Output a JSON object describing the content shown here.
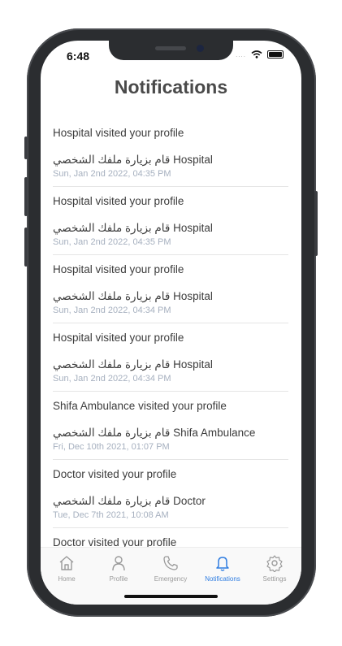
{
  "status": {
    "time": "6:48",
    "signal_dots": "...."
  },
  "page": {
    "title": "Notifications"
  },
  "notifications": [
    {
      "line1": "Hospital visited your profile",
      "line2": "قام بزيارة ملفك الشخصي Hospital",
      "date": "Sun, Jan 2nd 2022, 04:35 PM"
    },
    {
      "line1": "Hospital visited your profile",
      "line2": "قام بزيارة ملفك الشخصي Hospital",
      "date": "Sun, Jan 2nd 2022, 04:35 PM"
    },
    {
      "line1": "Hospital visited your profile",
      "line2": "قام بزيارة ملفك الشخصي Hospital",
      "date": "Sun, Jan 2nd 2022, 04:34 PM"
    },
    {
      "line1": "Hospital visited your profile",
      "line2": "قام بزيارة ملفك الشخصي Hospital",
      "date": "Sun, Jan 2nd 2022, 04:34 PM"
    },
    {
      "line1": "Shifa Ambulance visited your profile",
      "line2": "قام بزيارة ملفك الشخصي Shifa Ambulance",
      "date": "Fri, Dec 10th 2021, 01:07 PM"
    },
    {
      "line1": "Doctor visited your profile",
      "line2": "قام بزيارة ملفك الشخصي Doctor",
      "date": "Tue, Dec 7th 2021, 10:08 AM"
    },
    {
      "line1": "Doctor visited your profile",
      "line2": "",
      "date": ""
    }
  ],
  "tabbar": {
    "active_color": "#2f7de1",
    "inactive_color": "#9a9a9a",
    "tabs": [
      {
        "label": "Home",
        "icon": "home-icon"
      },
      {
        "label": "Profile",
        "icon": "person-icon"
      },
      {
        "label": "Emergency",
        "icon": "phone-icon"
      },
      {
        "label": "Notifications",
        "icon": "bell-icon",
        "active": true
      },
      {
        "label": "Settings",
        "icon": "gear-icon"
      }
    ]
  }
}
